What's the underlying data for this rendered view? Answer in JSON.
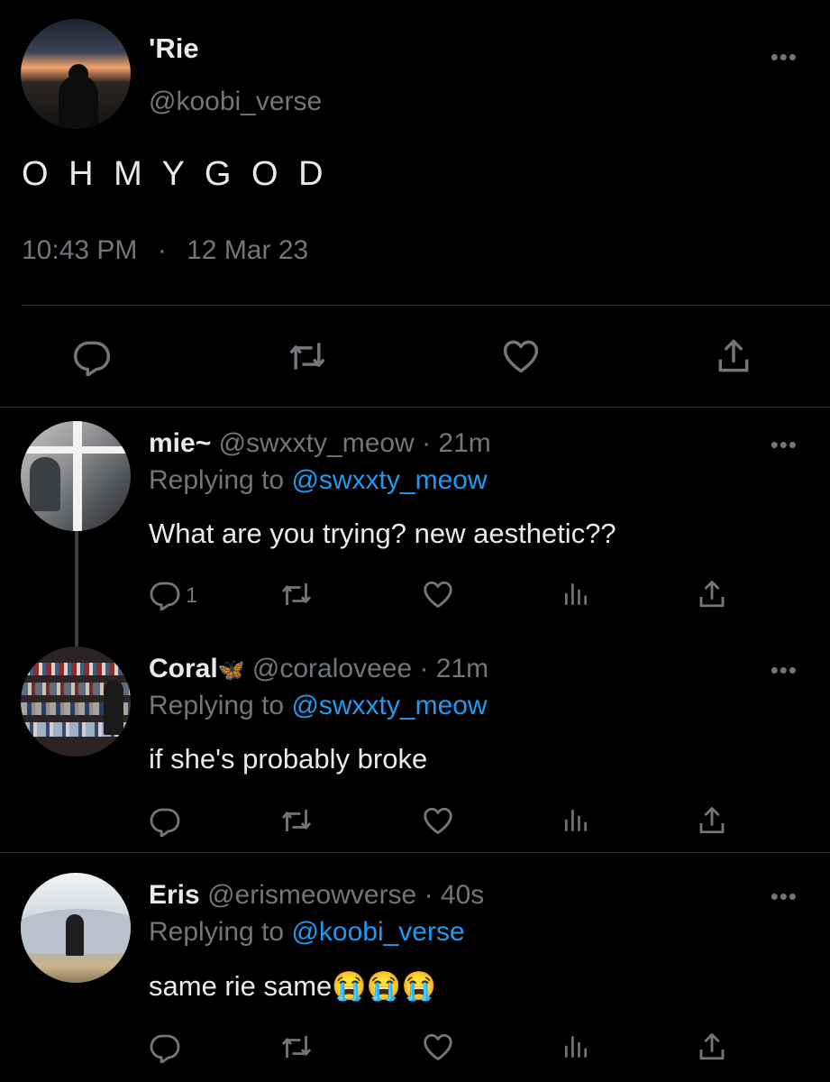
{
  "main_tweet": {
    "name": "'Rie",
    "handle": "@koobi_verse",
    "text": "O H M Y G O D",
    "time": "10:43 PM",
    "separator": "·",
    "date": "12 Mar 23",
    "more_glyph": "•••"
  },
  "replies": [
    {
      "name": "mie~",
      "handle": "@swxxty_meow",
      "age": "· 21m",
      "replying_label": "Replying to",
      "replying_to": "@swxxty_meow",
      "text": "What are you trying? new aesthetic??",
      "reply_count": "1",
      "more_glyph": "•••"
    },
    {
      "name": "Coral",
      "name_emoji": "🦋",
      "handle": "@coraloveee",
      "age": "· 21m",
      "replying_label": "Replying to",
      "replying_to": "@swxxty_meow",
      "text": "if she's probably broke",
      "more_glyph": "•••"
    },
    {
      "name": "Eris",
      "handle": "@erismeowverse",
      "age": "· 40s",
      "replying_label": "Replying to",
      "replying_to": "@koobi_verse",
      "text": "same rie same😭😭😭",
      "more_glyph": "•••"
    }
  ],
  "icons": [
    "reply-icon",
    "retweet-icon",
    "like-icon",
    "views-icon",
    "share-icon",
    "more-icon"
  ],
  "colors": {
    "background": "#000000",
    "text": "#e7e9ea",
    "muted": "#71767b",
    "link": "#1d9bf0",
    "divider": "#2f3336"
  }
}
